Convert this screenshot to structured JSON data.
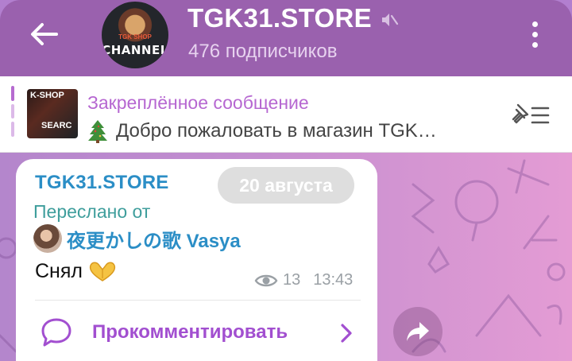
{
  "header": {
    "title": "TGK31.STORE",
    "subtitle": "476 подписчиков",
    "avatar_text_small": "TGK SHOP",
    "avatar_text": "CHANNEL",
    "background_color": "#9a61ae"
  },
  "pinned": {
    "title": "Закреплённое сообщение",
    "text": "Добро пожаловать в магазин TGK…",
    "thumb_text_top": "K-SHOP",
    "thumb_text_bottom": "SEARC"
  },
  "message": {
    "sender": "TGK31.STORE",
    "date": "20 августа",
    "forwarded_label": "Переслано от",
    "forwarded_from": "夜更かしの歌 Vasya",
    "text": "Снял",
    "views": "13",
    "time": "13:43",
    "comment_label": "Прокомментировать"
  },
  "icons": {
    "back": "arrow-left-icon",
    "mute": "muted-speaker-icon",
    "menu": "more-vertical-icon",
    "pinned_list": "pin-list-icon",
    "tree": "christmas-tree-emoji",
    "hands": "heart-hands-emoji",
    "views": "eye-icon",
    "comment": "comment-bubble-icon",
    "chevron": "chevron-right-icon",
    "share": "share-forward-icon"
  },
  "colors": {
    "accent": "#b667d1",
    "link": "#2b8ec6",
    "forward_label": "#3f9e9c"
  }
}
